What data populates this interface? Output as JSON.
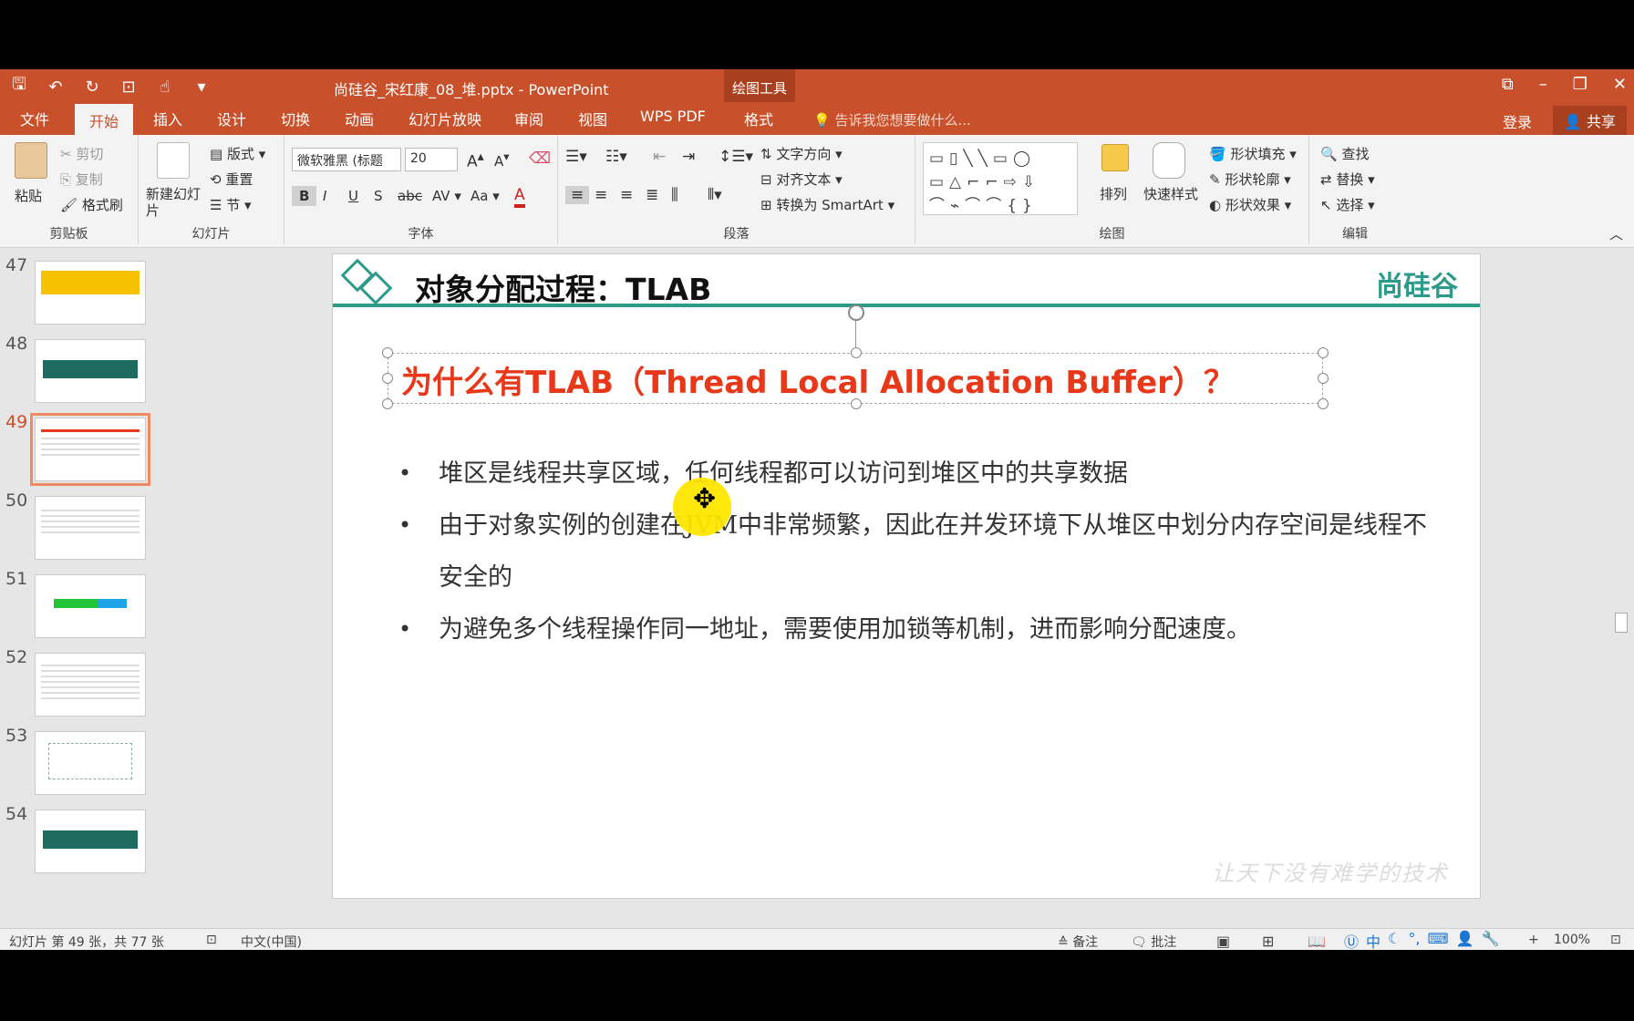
{
  "titlebar": {
    "document_title": "尚硅谷_宋红康_08_堆.pptx - PowerPoint",
    "context_group": "绘图工具"
  },
  "tabs": [
    {
      "label": "文件"
    },
    {
      "label": "开始"
    },
    {
      "label": "插入"
    },
    {
      "label": "设计"
    },
    {
      "label": "切换"
    },
    {
      "label": "动画"
    },
    {
      "label": "幻灯片放映"
    },
    {
      "label": "审阅"
    },
    {
      "label": "视图"
    },
    {
      "label": "WPS PDF"
    },
    {
      "label": "格式"
    }
  ],
  "tell_me": "告诉我您想要做什么...",
  "login": "登录",
  "share": "共享",
  "ribbon": {
    "clipboard": {
      "paste": "粘贴",
      "cut": "剪切",
      "copy": "复制",
      "format_painter": "格式刷",
      "label": "剪贴板"
    },
    "slides": {
      "new_slide": "新建幻灯片",
      "layout": "版式",
      "reset": "重置",
      "section": "节",
      "label": "幻灯片"
    },
    "font": {
      "family": "微软雅黑 (标题",
      "size": "20",
      "label": "字体"
    },
    "paragraph": {
      "text_direction": "文字方向",
      "align_text": "对齐文本",
      "smartart": "转换为 SmartArt",
      "label": "段落"
    },
    "drawing": {
      "arrange": "排列",
      "quick_styles": "快速样式",
      "shape_fill": "形状填充",
      "shape_outline": "形状轮廓",
      "shape_effects": "形状效果",
      "label": "绘图"
    },
    "editing": {
      "find": "查找",
      "replace": "替换",
      "select": "选择",
      "label": "编辑"
    }
  },
  "thumbnails": [
    {
      "num": "47"
    },
    {
      "num": "48"
    },
    {
      "num": "49"
    },
    {
      "num": "50"
    },
    {
      "num": "51"
    },
    {
      "num": "52"
    },
    {
      "num": "53"
    },
    {
      "num": "54"
    }
  ],
  "slide": {
    "title": "对象分配过程：TLAB",
    "logo": "尚硅谷",
    "headline": "为什么有TLAB（Thread Local Allocation Buffer）？",
    "bullets": [
      "堆区是线程共享区域，任何线程都可以访问到堆区中的共享数据",
      "由于对象实例的创建在JVM中非常频繁，因此在并发环境下从堆区中划分内存空间是线程不安全的",
      "为避免多个线程操作同一地址，需要使用加锁等机制，进而影响分配速度。"
    ],
    "watermark": "让天下没有难学的技术"
  },
  "statusbar": {
    "slide_info": "幻灯片 第 49 张，共 77 张",
    "language": "中文(中国)",
    "notes": "备注",
    "comments": "批注",
    "zoom": "100%"
  },
  "colors": {
    "accent": "#c8502b",
    "teal": "#2e9b8a",
    "headline_red": "#e8381a"
  }
}
